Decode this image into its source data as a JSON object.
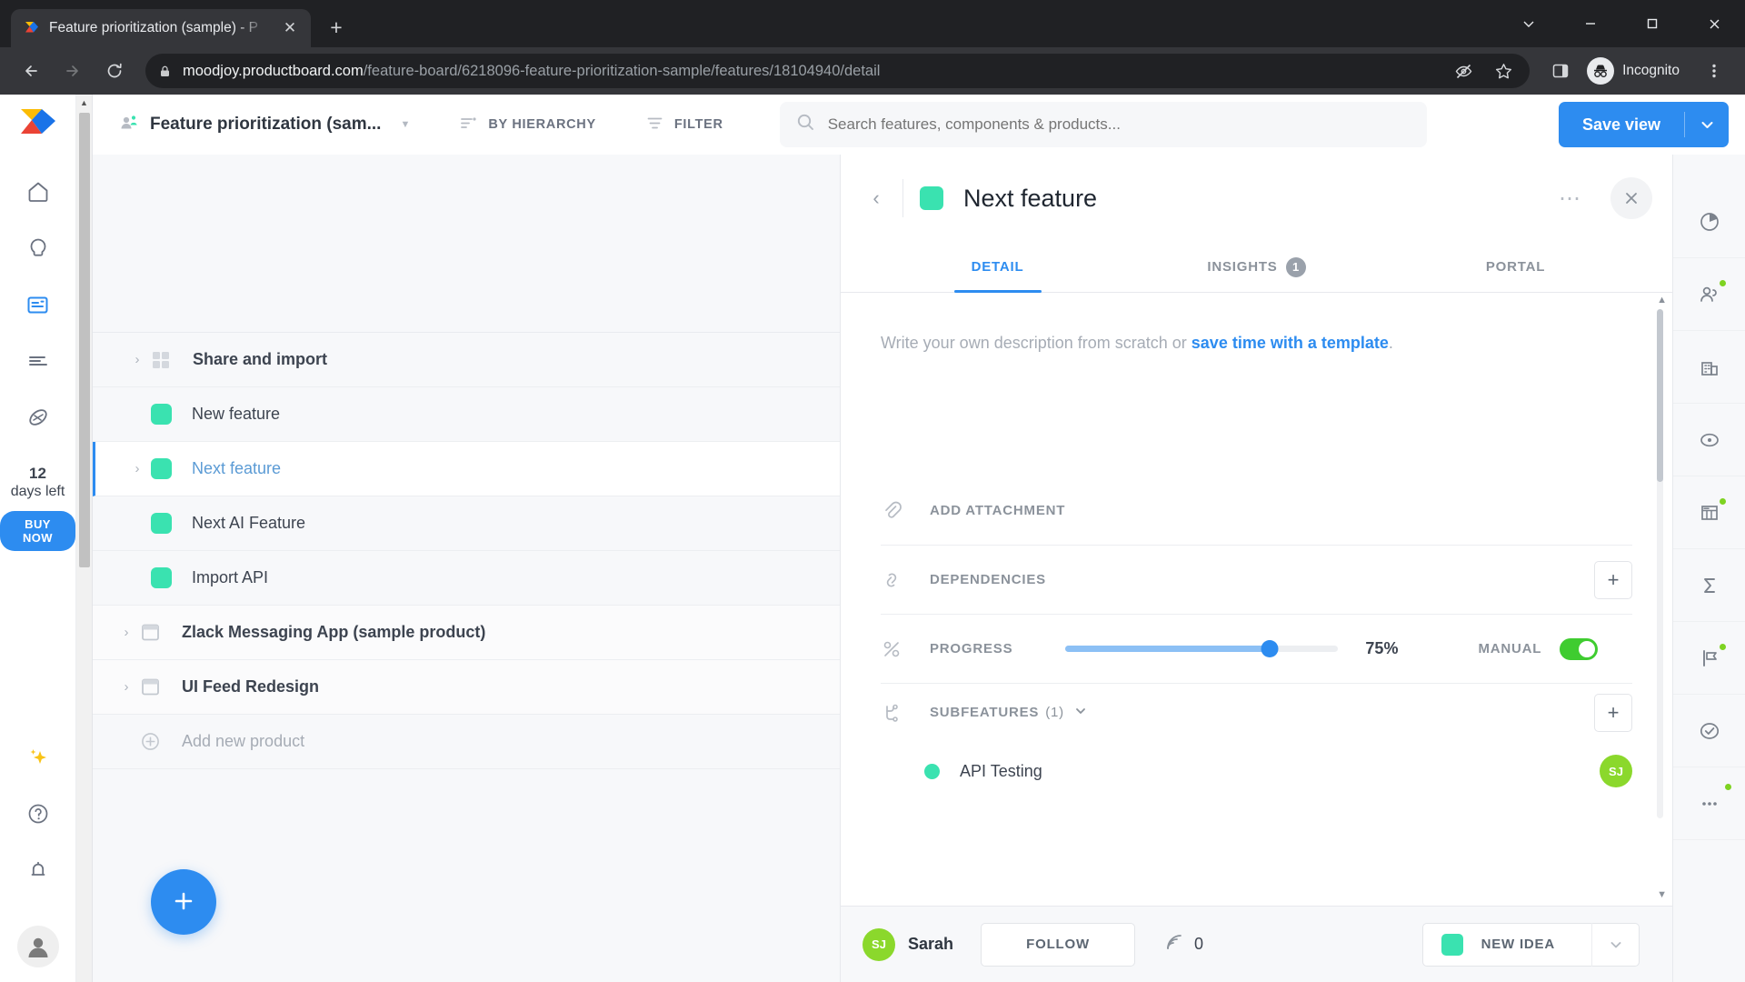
{
  "browser": {
    "tab_title": "Feature prioritization (sample) - P",
    "url_domain": "moodjoy.productboard.com",
    "url_path": "/feature-board/6218096-feature-prioritization-sample/features/18104940/detail",
    "profile_label": "Incognito",
    "icons": {
      "back": "back-arrow-icon",
      "forward": "forward-arrow-icon",
      "reload": "reload-icon",
      "lock": "lock-icon",
      "eye_off": "eye-off-icon",
      "bookmark": "star-icon",
      "side_panel": "side-panel-icon",
      "menu": "three-dot-menu-icon",
      "minimize": "minimize-icon",
      "maximize": "maximize-icon",
      "close": "close-icon",
      "new_tab": "new-tab-plus-icon",
      "tab_close": "tab-close-icon"
    }
  },
  "sidebar": {
    "items": [
      {
        "name": "home",
        "icon": "home-icon",
        "active": false
      },
      {
        "name": "insights",
        "icon": "lightbulb-icon",
        "active": false
      },
      {
        "name": "features",
        "icon": "features-board-icon",
        "active": true
      },
      {
        "name": "roadmap",
        "icon": "roadmap-lines-icon",
        "active": false
      },
      {
        "name": "objectives",
        "icon": "objectives-icon",
        "active": false
      }
    ],
    "trial_days": "12",
    "trial_text": "days left",
    "buy_now_label": "BUY NOW",
    "bottom_items": [
      {
        "name": "ai-sparkle",
        "icon": "sparkle-icon"
      },
      {
        "name": "help",
        "icon": "question-circle-icon"
      },
      {
        "name": "notifications",
        "icon": "bell-icon"
      }
    ],
    "avatar": "user-avatar-icon"
  },
  "topbar": {
    "board_name": "Feature prioritization (sam...",
    "board_icon": "board-users-icon",
    "hierarchy_label": "BY HIERARCHY",
    "hierarchy_icon": "hierarchy-icon",
    "filter_label": "FILTER",
    "filter_icon": "filter-icon",
    "search_placeholder": "Search features, components & products...",
    "search_value": "",
    "search_icon": "search-icon",
    "save_view_label": "Save view",
    "save_view_arrow_icon": "chevron-down-icon",
    "accent_color": "#2d8cf0"
  },
  "feature_list": {
    "rows": [
      {
        "label": "Share and import",
        "type": "component",
        "icon": "grid-icon",
        "caret": true,
        "bold": true,
        "selected": false
      },
      {
        "label": "New feature",
        "type": "feature",
        "icon": "swatch",
        "caret": false,
        "bold": false,
        "selected": false
      },
      {
        "label": "Next feature",
        "type": "feature",
        "icon": "swatch",
        "caret": true,
        "bold": false,
        "selected": true
      },
      {
        "label": "Next AI Feature",
        "type": "feature",
        "icon": "swatch",
        "caret": false,
        "bold": false,
        "selected": false
      },
      {
        "label": "Import API",
        "type": "feature",
        "icon": "swatch",
        "caret": false,
        "bold": false,
        "selected": false
      },
      {
        "label": "Zlack Messaging App (sample product)",
        "type": "product",
        "icon": "product-icon",
        "caret": true,
        "bold": true,
        "selected": false
      },
      {
        "label": "UI Feed Redesign",
        "type": "product",
        "icon": "product-icon",
        "caret": true,
        "bold": true,
        "selected": false
      }
    ],
    "add_new_product_label": "Add new product",
    "add_new_product_icon": "plus-circle-icon",
    "fab_icon": "plus-icon",
    "swatch_color": "#3ae2b0"
  },
  "detail": {
    "back_icon": "chevron-left-icon",
    "title": "Next feature",
    "swatch_color": "#3ae2b0",
    "more_icon": "three-dot-menu-icon",
    "close_icon": "close-icon",
    "tabs": [
      {
        "label": "DETAIL",
        "badge": "",
        "active": true
      },
      {
        "label": "INSIGHTS",
        "badge": "1",
        "active": false
      },
      {
        "label": "PORTAL",
        "badge": "",
        "active": false
      }
    ],
    "description_prefix": "Write your own description from scratch or ",
    "description_link": "save time with a template",
    "description_suffix": ".",
    "add_attachment_label": "ADD ATTACHMENT",
    "add_attachment_icon": "paperclip-icon",
    "dependencies_label": "DEPENDENCIES",
    "dependencies_icon": "dependencies-link-icon",
    "dependencies_add_icon": "plus-icon",
    "progress_label": "PROGRESS",
    "progress_icon": "percent-icon",
    "progress_value": 75,
    "progress_text": "75%",
    "manual_label": "MANUAL",
    "manual_on": true,
    "subfeatures_label": "SUBFEATURES",
    "subfeatures_count": "(1)",
    "subfeatures_icon": "subfeatures-tree-icon",
    "subfeatures_chevron_icon": "chevron-down-icon",
    "subfeatures_add_icon": "plus-icon",
    "subfeatures": [
      {
        "name": "API Testing",
        "dot_color": "#3ae2b0",
        "assignee_initials": "SJ"
      }
    ],
    "footer": {
      "owner_initials": "SJ",
      "owner_name": "Sarah",
      "follow_label": "FOLLOW",
      "insight_icon": "insights-signal-icon",
      "insight_count": "0",
      "status_label": "NEW IDEA",
      "status_color": "#3ae2b0",
      "status_arrow_icon": "chevron-down-icon"
    }
  },
  "right_rail": {
    "items": [
      {
        "name": "history",
        "icon": "pie-history-icon",
        "dot": false
      },
      {
        "name": "users",
        "icon": "users-icon",
        "dot": true
      },
      {
        "name": "companies",
        "icon": "company-building-icon",
        "dot": false
      },
      {
        "name": "objectives",
        "icon": "target-icon",
        "dot": false
      },
      {
        "name": "scorecard",
        "icon": "calculator-icon",
        "dot": true
      },
      {
        "name": "formula",
        "icon": "sigma-icon",
        "dot": false
      },
      {
        "name": "releases",
        "icon": "release-flag-icon",
        "dot": true
      },
      {
        "name": "status",
        "icon": "check-circle-icon",
        "dot": false
      },
      {
        "name": "more",
        "icon": "more-dots-icon",
        "dot": true
      }
    ]
  }
}
